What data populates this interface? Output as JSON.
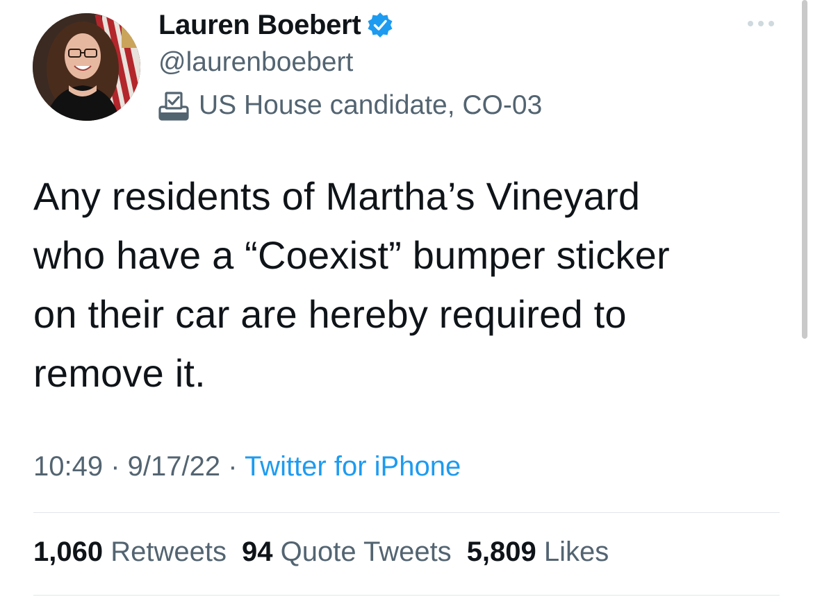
{
  "author": {
    "display_name": "Lauren Boebert",
    "handle": "@laurenboebert",
    "label": "US House candidate, CO-03",
    "verified": true,
    "verified_icon": "verified-badge-icon",
    "label_icon": "ballot-box-icon"
  },
  "tweet": {
    "lines": [
      "Any residents of Martha’s Vineyard",
      "who have a “Coexist” bumper sticker",
      "on their car are hereby required to",
      "remove it."
    ]
  },
  "meta": {
    "time": "10:49",
    "sep1": " · ",
    "date": "9/17/22",
    "sep2": " · ",
    "source": "Twitter for iPhone"
  },
  "stats": {
    "retweets_count": "1,060",
    "retweets_label": "Retweets",
    "quotes_count": "94",
    "quotes_label": "Quote Tweets",
    "likes_count": "5,809",
    "likes_label": "Likes"
  },
  "colors": {
    "accent": "#1d9bf0",
    "primary_text": "#0f1419",
    "secondary_text": "#536471",
    "divider": "#e1e6ea"
  }
}
